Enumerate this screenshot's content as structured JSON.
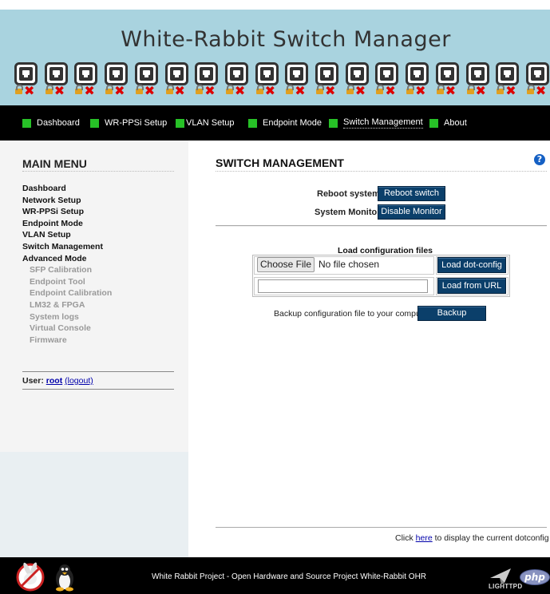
{
  "header": {
    "title": "White-Rabbit Switch Manager",
    "port_count": 18,
    "port_status": "unlocked-down"
  },
  "nav": {
    "items": [
      {
        "label": "Dashboard"
      },
      {
        "label": "WR-PPSi Setup"
      },
      {
        "label": "VLAN Setup"
      },
      {
        "label": "Endpoint Mode"
      },
      {
        "label": "Switch Management",
        "active": true
      },
      {
        "label": "About"
      }
    ],
    "accent": "#27c127"
  },
  "sidebar": {
    "title": "MAIN MENU",
    "items": [
      {
        "label": "Dashboard"
      },
      {
        "label": "Network Setup"
      },
      {
        "label": "WR-PPSi Setup"
      },
      {
        "label": "Endpoint Mode"
      },
      {
        "label": "VLAN Setup"
      },
      {
        "label": "Switch Management"
      },
      {
        "label": "Advanced Mode"
      }
    ],
    "subitems": [
      {
        "label": "SFP Calibration"
      },
      {
        "label": "Endpoint Tool"
      },
      {
        "label": "Endpoint Calibration"
      },
      {
        "label": "LM32 & FPGA"
      },
      {
        "label": "System logs"
      },
      {
        "label": "Virtual Console"
      },
      {
        "label": "Firmware"
      }
    ],
    "user_label": "User:",
    "user_name": "root",
    "logout": "(logout)"
  },
  "main": {
    "title": "SWITCH MANAGEMENT",
    "help_icon": "?",
    "reboot_label": "Reboot system:",
    "reboot_button": "Reboot switch",
    "monitor_label": "System Monitor:",
    "monitor_button": "Disable Monitor",
    "load_title": "Load configuration files",
    "choose_file": "Choose File",
    "no_file": "No file chosen",
    "load_dot_config": "Load dot-config",
    "url_value": "",
    "load_from_url": "Load from URL",
    "backup_label": "Backup configuration file to your computer",
    "backup_button": "Backup",
    "dotconfig_pre": "Click ",
    "dotconfig_link": "here",
    "dotconfig_post": " to display the current dotconfig file"
  },
  "footer": {
    "text": "White Rabbit Project - Open Hardware and Source Project White-Rabbit OHR",
    "lighttpd": "LIGHTTPD",
    "php": "php"
  }
}
